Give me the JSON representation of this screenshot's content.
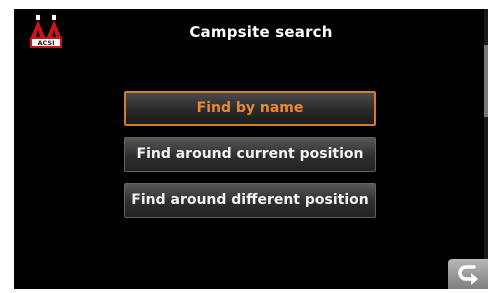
{
  "header": {
    "title": "Campsite search",
    "logo_text": "ACSI"
  },
  "menu": {
    "items": [
      {
        "label": "Find by name",
        "selected": true
      },
      {
        "label": "Find around current position",
        "selected": false
      },
      {
        "label": "Find around different position",
        "selected": false
      }
    ]
  },
  "colors": {
    "screen_background": "#000000",
    "selected_accent": "#e88a35",
    "logo_red": "#c4161c"
  },
  "icons": {
    "logo": "acsi-tents-logo",
    "back": "back-arrow-icon"
  }
}
